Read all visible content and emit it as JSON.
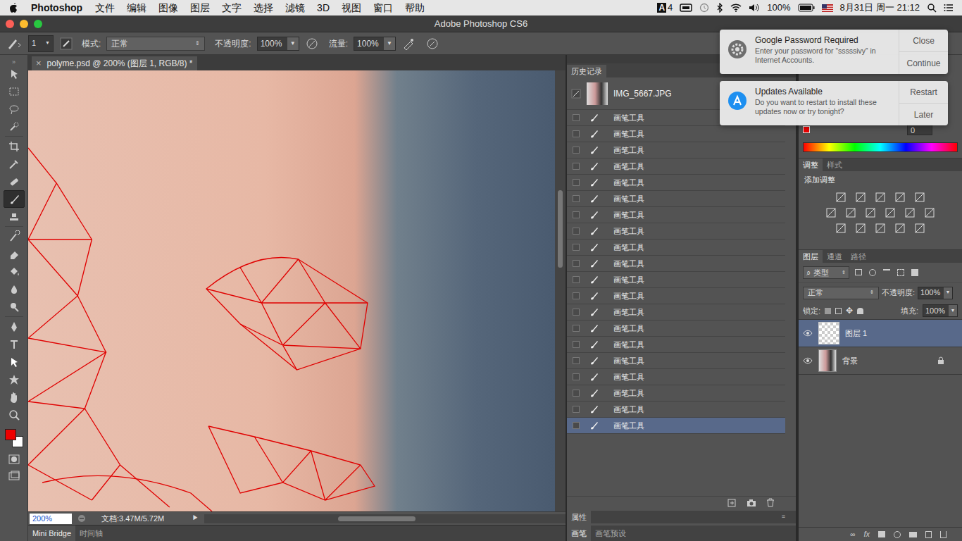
{
  "menubar": {
    "app": "Photoshop",
    "items": [
      "文件",
      "编辑",
      "图像",
      "图层",
      "文字",
      "选择",
      "滤镜",
      "3D",
      "视图",
      "窗口",
      "帮助"
    ],
    "input_source": "A",
    "input_count": "4",
    "battery": "100%",
    "datetime": "8月31日 周一 21:12"
  },
  "window": {
    "title": "Adobe Photoshop CS6"
  },
  "options": {
    "brush_size": "1",
    "mode_label": "模式:",
    "mode": "正常",
    "opacity_label": "不透明度:",
    "opacity": "100%",
    "flow_label": "流量:",
    "flow": "100%"
  },
  "tools": [
    {
      "selected": false
    },
    {
      "selected": false
    },
    {
      "selected": false
    },
    {
      "selected": false
    },
    {
      "selected": false
    },
    {
      "selected": false
    },
    {
      "selected": false
    },
    {
      "selected": true
    },
    {
      "selected": false
    },
    {
      "selected": false
    },
    {
      "selected": false
    },
    {
      "selected": false
    },
    {
      "selected": false
    },
    {
      "selected": false
    },
    {
      "selected": false
    },
    {
      "selected": false
    },
    {
      "selected": false
    },
    {
      "selected": false
    },
    {
      "selected": false
    },
    {
      "selected": false
    }
  ],
  "swatches": [
    {
      "color": "#ee0000"
    },
    {
      "color": "#ffffff"
    }
  ],
  "document": {
    "tab": "polyme.psd @ 200% (图层 1, RGB/8) *",
    "close": "×"
  },
  "status_bar": {
    "zoom": "200%",
    "doc_size": "文档:3.47M/5.72M",
    "arrow": "▶"
  },
  "bottom_tabs": [
    {
      "label": "Mini Bridge",
      "selected": true
    },
    {
      "label": "时间轴",
      "selected": false
    }
  ],
  "history": {
    "tab": "历史记录",
    "snapshot": "IMG_5667.JPG",
    "items": [
      {
        "label": "画笔工具",
        "selected": false
      },
      {
        "label": "画笔工具",
        "selected": false
      },
      {
        "label": "画笔工具",
        "selected": false
      },
      {
        "label": "画笔工具",
        "selected": false
      },
      {
        "label": "画笔工具",
        "selected": false
      },
      {
        "label": "画笔工具",
        "selected": false
      },
      {
        "label": "画笔工具",
        "selected": false
      },
      {
        "label": "画笔工具",
        "selected": false
      },
      {
        "label": "画笔工具",
        "selected": false
      },
      {
        "label": "画笔工具",
        "selected": false
      },
      {
        "label": "画笔工具",
        "selected": false
      },
      {
        "label": "画笔工具",
        "selected": false
      },
      {
        "label": "画笔工具",
        "selected": false
      },
      {
        "label": "画笔工具",
        "selected": false
      },
      {
        "label": "画笔工具",
        "selected": false
      },
      {
        "label": "画笔工具",
        "selected": false
      },
      {
        "label": "画笔工具",
        "selected": false
      },
      {
        "label": "画笔工具",
        "selected": false
      },
      {
        "label": "画笔工具",
        "selected": false
      },
      {
        "label": "画笔工具",
        "selected": true
      }
    ]
  },
  "properties_tab": "属性",
  "brush_tabs": [
    {
      "label": "画笔",
      "selected": true
    },
    {
      "label": "画笔预设",
      "selected": false
    }
  ],
  "color_panel": {
    "value": "0"
  },
  "adjustments": {
    "tabs": [
      {
        "label": "调整",
        "selected": true
      },
      {
        "label": "样式",
        "selected": false
      }
    ],
    "title": "添加调整"
  },
  "layers": {
    "tabs": [
      {
        "label": "图层",
        "selected": true
      },
      {
        "label": "通道",
        "selected": false
      },
      {
        "label": "路径",
        "selected": false
      }
    ],
    "filter": "类型",
    "blend": "正常",
    "opacity_label": "不透明度:",
    "opacity": "100%",
    "lock_label": "锁定:",
    "fill_label": "填充:",
    "fill": "100%",
    "fx": "fx",
    "items": [
      {
        "name": "图层 1",
        "selected": true,
        "visible": true,
        "locked": false
      },
      {
        "name": "背景",
        "selected": false,
        "visible": true,
        "locked": true
      }
    ]
  },
  "notifications": [
    {
      "title": "Google Password Required",
      "body": "Enter your password for “sssssivy” in Internet Accounts.",
      "buttons": [
        "Close",
        "Continue"
      ]
    },
    {
      "title": "Updates Available",
      "body": "Do you want to restart to install these updates now or try tonight?",
      "buttons": [
        "Restart",
        "Later"
      ]
    }
  ]
}
